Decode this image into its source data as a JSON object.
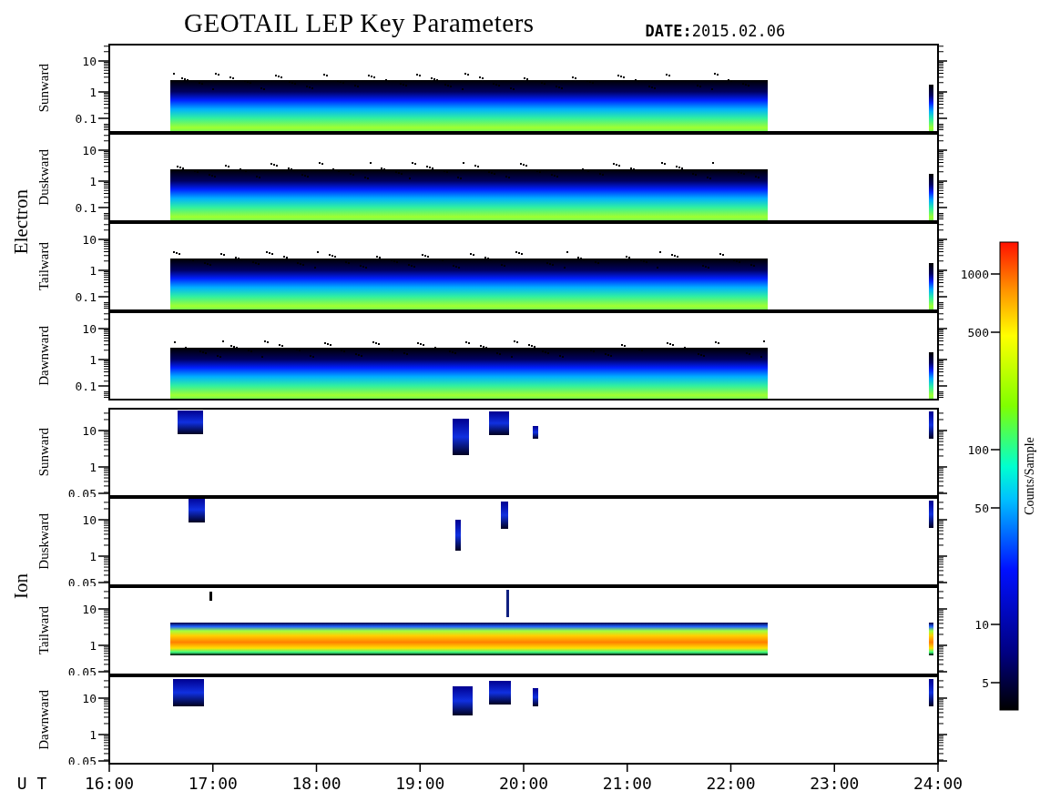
{
  "title": "GEOTAIL LEP Key Parameters",
  "date": "**DATE:**2015.02.06",
  "groups": [
    {
      "species": "Electron",
      "panels": [
        {
          "direction": "Sunward",
          "kind": "electron",
          "yticks": [
            "10",
            "1",
            "0.1"
          ]
        },
        {
          "direction": "Duskward",
          "kind": "electron",
          "yticks": [
            "10",
            "1",
            "0.1"
          ]
        },
        {
          "direction": "Tailward",
          "kind": "electron",
          "yticks": [
            "10",
            "1",
            "0.1"
          ]
        },
        {
          "direction": "Dawnward",
          "kind": "electron",
          "yticks": [
            "10",
            "1",
            "0.1"
          ]
        }
      ]
    },
    {
      "species": "Ion",
      "panels": [
        {
          "direction": "Sunward",
          "kind": "ion-burst",
          "yticks": [
            "10",
            "1",
            "0.05"
          ]
        },
        {
          "direction": "Duskward",
          "kind": "ion-burst",
          "yticks": [
            "10",
            "1",
            "0.05"
          ]
        },
        {
          "direction": "Tailward",
          "kind": "ion-beam",
          "yticks": [
            "10",
            "1",
            "0.05"
          ]
        },
        {
          "direction": "Dawnward",
          "kind": "ion-burst",
          "yticks": [
            "10",
            "1",
            "0.05"
          ]
        }
      ]
    }
  ],
  "time_axis": {
    "label": "U T",
    "ticks": [
      "16:00",
      "17:00",
      "18:00",
      "19:00",
      "20:00",
      "21:00",
      "22:00",
      "23:00",
      "24:00"
    ]
  },
  "colorbar": {
    "title": "Counts/Sample",
    "ticks": [
      "1000",
      "500",
      "100",
      "50",
      "10",
      "5"
    ]
  }
}
